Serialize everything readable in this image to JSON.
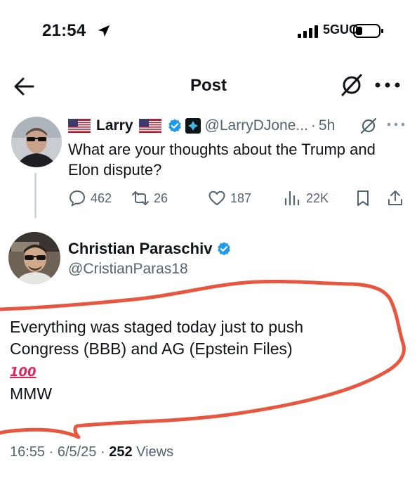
{
  "status_bar": {
    "time": "21:54",
    "network": "5GUC"
  },
  "header": {
    "title": "Post"
  },
  "quoted_tweet": {
    "name": "Larry",
    "handle": "@LarryDJone...",
    "separator": "·",
    "time": "5h",
    "text": "What are your thoughts about the Trump and Elon dispute?",
    "stats": {
      "replies": "462",
      "reposts": "26",
      "likes": "187",
      "views": "22K"
    }
  },
  "main_tweet": {
    "name": "Christian Paraschiv",
    "handle": "@CristianParas18",
    "line1": "Everything was staged today just to push",
    "line2": "Congress (BBB) and AG (Epstein Files)",
    "emoji": "100",
    "line3": "MMW",
    "timestamp": "16:55 · 6/5/25 ·",
    "views_count": "252",
    "views_label": "Views"
  },
  "icons": {
    "location": "location-arrow-icon",
    "signal": "signal-bars-icon",
    "battery": "battery-icon",
    "back": "back-arrow-icon",
    "grok": "grok-icon",
    "more": "more-horizontal-icon",
    "reply": "reply-icon",
    "repost": "repost-icon",
    "like": "heart-icon",
    "views": "views-chart-icon",
    "bookmark": "bookmark-icon",
    "share": "share-icon"
  },
  "colors": {
    "verified": "#1d9bf0",
    "secondary_text": "#536471",
    "annotation": "#e8563f",
    "emoji": "#e0245e"
  }
}
